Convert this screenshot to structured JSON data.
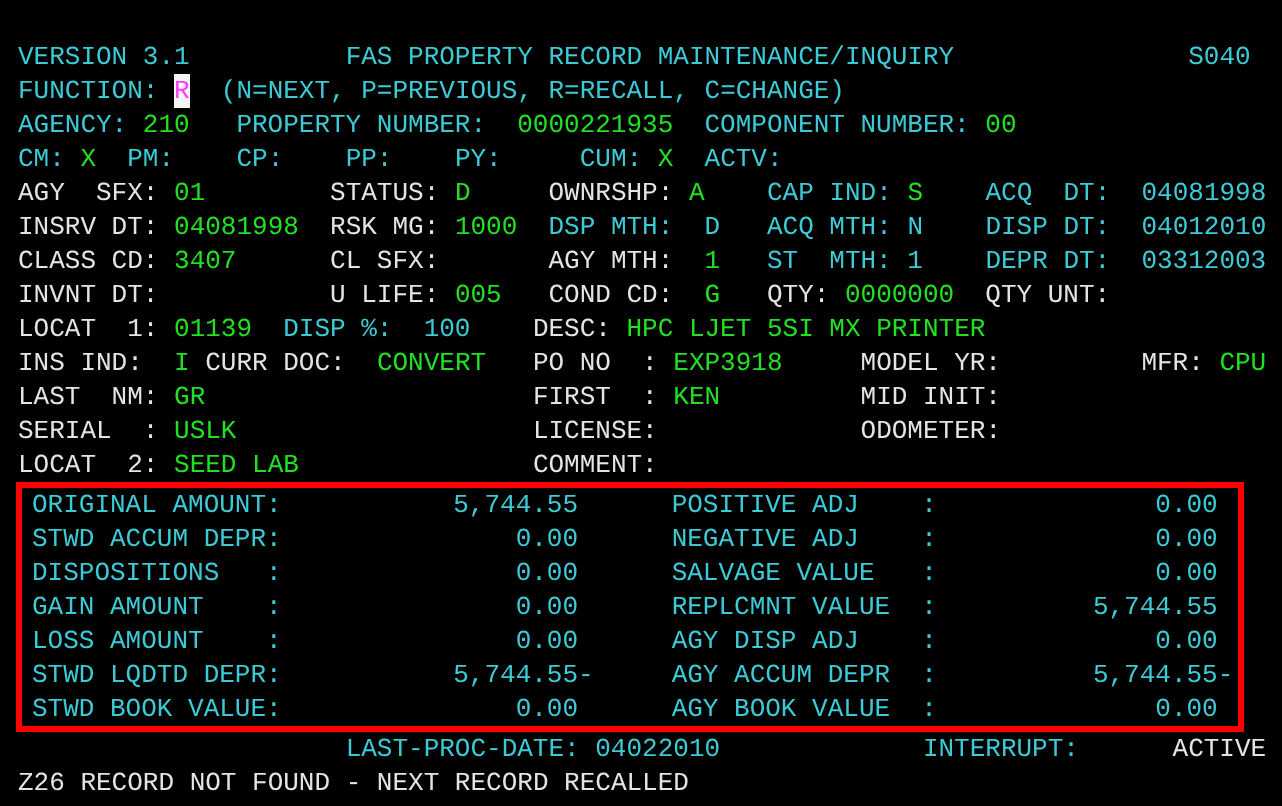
{
  "screen_lines": [
    [
      {
        "text": "VERSION 3.1",
        "kind": "info"
      },
      {
        "text": "FAS PROPERTY RECORD MAINTENANCE/INQUIRY",
        "kind": "info"
      },
      {
        "text": "S040",
        "kind": "info"
      }
    ],
    [
      {
        "text": "FUNCTION:",
        "kind": "info"
      },
      {
        "text": "R",
        "kind": "cursor"
      },
      {
        "text": "(N=NEXT, P=PREVIOUS, R=RECALL, C=CHANGE)",
        "kind": "info"
      }
    ],
    [
      {
        "text": "AGENCY:",
        "kind": "info"
      },
      {
        "text": "210",
        "kind": "value"
      },
      {
        "text": "PROPERTY NUMBER:",
        "kind": "info"
      },
      {
        "text": "0000221935",
        "kind": "value"
      },
      {
        "text": "COMPONENT NUMBER:",
        "kind": "info"
      },
      {
        "text": "00",
        "kind": "value"
      }
    ],
    [
      {
        "text": "CM:",
        "kind": "info"
      },
      {
        "text": "X",
        "kind": "value"
      },
      {
        "text": "PM:",
        "kind": "info"
      },
      {
        "text": "CP:",
        "kind": "info"
      },
      {
        "text": "PP:",
        "kind": "info"
      },
      {
        "text": "PY:",
        "kind": "info"
      },
      {
        "text": "CUM:",
        "kind": "info"
      },
      {
        "text": "X",
        "kind": "value"
      },
      {
        "text": "ACTV:",
        "kind": "info"
      }
    ],
    [
      {
        "text": "AGY  SFX:",
        "kind": "label"
      },
      {
        "text": "01",
        "kind": "value"
      },
      {
        "text": "STATUS:",
        "kind": "label"
      },
      {
        "text": "D",
        "kind": "value"
      },
      {
        "text": "OWNRSHP:",
        "kind": "label"
      },
      {
        "text": "A",
        "kind": "value"
      },
      {
        "text": "CAP IND:",
        "kind": "info"
      },
      {
        "text": "S",
        "kind": "value"
      },
      {
        "text": "ACQ  DT:",
        "kind": "info"
      },
      {
        "text": "04081998",
        "kind": "info"
      }
    ],
    [
      {
        "text": "INSRV DT:",
        "kind": "label"
      },
      {
        "text": "04081998",
        "kind": "value"
      },
      {
        "text": "RSK MG:",
        "kind": "label"
      },
      {
        "text": "1000",
        "kind": "value"
      },
      {
        "text": "DSP MTH:",
        "kind": "info"
      },
      {
        "text": "D",
        "kind": "info"
      },
      {
        "text": "ACQ MTH:",
        "kind": "info"
      },
      {
        "text": "N",
        "kind": "info"
      },
      {
        "text": "DISP DT:",
        "kind": "info"
      },
      {
        "text": "04012010",
        "kind": "info"
      }
    ],
    [
      {
        "text": "CLASS CD:",
        "kind": "label"
      },
      {
        "text": "3407",
        "kind": "value"
      },
      {
        "text": "CL SFX:",
        "kind": "label"
      },
      {
        "text": "AGY MTH:",
        "kind": "label"
      },
      {
        "text": "1",
        "kind": "value"
      },
      {
        "text": "ST  MTH:",
        "kind": "info"
      },
      {
        "text": "1",
        "kind": "info"
      },
      {
        "text": "DEPR DT:",
        "kind": "info"
      },
      {
        "text": "03312003",
        "kind": "info"
      }
    ],
    [
      {
        "text": "INVNT DT:",
        "kind": "label"
      },
      {
        "text": "U LIFE:",
        "kind": "label"
      },
      {
        "text": "005",
        "kind": "value"
      },
      {
        "text": "COND CD:",
        "kind": "label"
      },
      {
        "text": "G",
        "kind": "value"
      },
      {
        "text": "QTY:",
        "kind": "label"
      },
      {
        "text": "0000000",
        "kind": "value"
      },
      {
        "text": "QTY UNT:",
        "kind": "label"
      }
    ],
    [
      {
        "text": "LOCAT  1:",
        "kind": "label"
      },
      {
        "text": "01139",
        "kind": "value"
      },
      {
        "text": "DISP %:",
        "kind": "info"
      },
      {
        "text": "100",
        "kind": "info"
      },
      {
        "text": "DESC:",
        "kind": "label"
      },
      {
        "text": "HPC LJET 5SI MX PRINTER",
        "kind": "value"
      }
    ],
    [
      {
        "text": "INS IND:",
        "kind": "label"
      },
      {
        "text": "I",
        "kind": "value"
      },
      {
        "text": "CURR DOC:",
        "kind": "label"
      },
      {
        "text": "CONVERT",
        "kind": "value"
      },
      {
        "text": "PO NO  :",
        "kind": "label"
      },
      {
        "text": "EXP3918",
        "kind": "value"
      },
      {
        "text": "MODEL YR:",
        "kind": "label"
      },
      {
        "text": "MFR:",
        "kind": "label"
      },
      {
        "text": "CPU",
        "kind": "value"
      }
    ],
    [
      {
        "text": "LAST  NM:",
        "kind": "label"
      },
      {
        "text": "GR",
        "kind": "value"
      },
      {
        "text": "FIRST  :",
        "kind": "label"
      },
      {
        "text": "KEN",
        "kind": "value"
      },
      {
        "text": "MID INIT:",
        "kind": "label"
      }
    ],
    [
      {
        "text": "SERIAL  :",
        "kind": "label"
      },
      {
        "text": "USLK",
        "kind": "value"
      },
      {
        "text": "LICENSE:",
        "kind": "label"
      },
      {
        "text": "ODOMETER:",
        "kind": "label"
      }
    ],
    [
      {
        "text": "LOCAT  2:",
        "kind": "label"
      },
      {
        "text": "SEED LAB",
        "kind": "value"
      },
      {
        "text": "COMMENT:",
        "kind": "label"
      }
    ]
  ],
  "totals": [
    {
      "left_label": "ORIGINAL AMOUNT:",
      "left_value": "5,744.55",
      "right_label": "POSITIVE ADJ    :",
      "right_value": "0.00"
    },
    {
      "left_label": "STWD ACCUM DEPR:",
      "left_value": "0.00",
      "right_label": "NEGATIVE ADJ    :",
      "right_value": "0.00"
    },
    {
      "left_label": "DISPOSITIONS   :",
      "left_value": "0.00",
      "right_label": "SALVAGE VALUE   :",
      "right_value": "0.00"
    },
    {
      "left_label": "GAIN AMOUNT    :",
      "left_value": "0.00",
      "right_label": "REPLCMNT VALUE  :",
      "right_value": "5,744.55"
    },
    {
      "left_label": "LOSS AMOUNT    :",
      "left_value": "0.00",
      "right_label": "AGY DISP ADJ    :",
      "right_value": "0.00"
    },
    {
      "left_label": "STWD LQDTD DEPR:",
      "left_value": "5,744.55-",
      "right_label": "AGY ACCUM DEPR  :",
      "right_value": "5,744.55-"
    },
    {
      "left_label": "STWD BOOK VALUE:",
      "left_value": "0.00",
      "right_label": "AGY BOOK VALUE  :",
      "right_value": "0.00"
    }
  ],
  "footer": [
    {
      "text": "LAST-PROC-DATE: 04022010",
      "kind": "info"
    },
    {
      "text": "INTERRUPT:",
      "kind": "info"
    },
    {
      "text": "ACTIVE",
      "kind": "label"
    }
  ],
  "message": "Z26 RECORD NOT FOUND - NEXT RECORD RECALLED"
}
